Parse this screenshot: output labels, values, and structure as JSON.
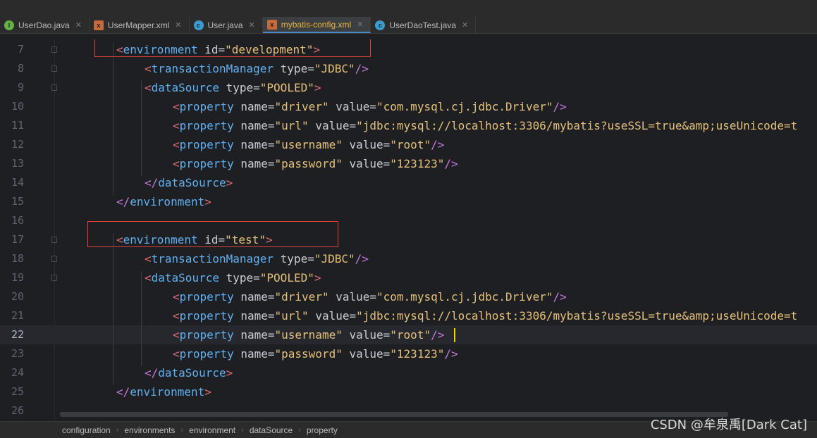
{
  "tabs": [
    {
      "label": "UserDao.java",
      "icon": "interface-icon",
      "icon_color": "#62b543",
      "icon_glyph": "I",
      "active": false
    },
    {
      "label": "UserMapper.xml",
      "icon": "xml-file-icon",
      "icon_color": "#c56a3a",
      "icon_glyph": "x",
      "active": false
    },
    {
      "label": "User.java",
      "icon": "class-icon",
      "icon_color": "#3d9ccf",
      "icon_glyph": "c",
      "active": false
    },
    {
      "label": "mybatis-config.xml",
      "icon": "xml-file-icon",
      "icon_color": "#c56a3a",
      "icon_glyph": "x",
      "active": true
    },
    {
      "label": "UserDaoTest.java",
      "icon": "test-class-icon",
      "icon_color": "#3d9ccf",
      "icon_glyph": "c",
      "active": false
    }
  ],
  "close_glyph": "✕",
  "current_line": 22,
  "lines": [
    {
      "n": "7",
      "tokens": [
        [
          "br",
          "<"
        ],
        [
          "tag",
          "environment"
        ],
        [
          "attr",
          " id"
        ],
        [
          "eq",
          "="
        ],
        [
          "val",
          "\"development\""
        ],
        [
          "br",
          ">"
        ]
      ],
      "indent": 2
    },
    {
      "n": "8",
      "tokens": [
        [
          "br",
          "<"
        ],
        [
          "tag",
          "transactionManager"
        ],
        [
          "attr",
          " type"
        ],
        [
          "eq",
          "="
        ],
        [
          "val",
          "\"JDBC\""
        ],
        [
          "close",
          "/>"
        ]
      ],
      "indent": 3
    },
    {
      "n": "9",
      "tokens": [
        [
          "br",
          "<"
        ],
        [
          "tag",
          "dataSource"
        ],
        [
          "attr",
          " type"
        ],
        [
          "eq",
          "="
        ],
        [
          "val",
          "\"POOLED\""
        ],
        [
          "br",
          ">"
        ]
      ],
      "indent": 3
    },
    {
      "n": "10",
      "tokens": [
        [
          "br",
          "<"
        ],
        [
          "tag",
          "property"
        ],
        [
          "attr",
          " name"
        ],
        [
          "eq",
          "="
        ],
        [
          "val",
          "\"driver\""
        ],
        [
          "attr",
          " value"
        ],
        [
          "eq",
          "="
        ],
        [
          "val",
          "\"com.mysql.cj.jdbc.Driver\""
        ],
        [
          "close",
          "/>"
        ]
      ],
      "indent": 4
    },
    {
      "n": "11",
      "tokens": [
        [
          "br",
          "<"
        ],
        [
          "tag",
          "property"
        ],
        [
          "attr",
          " name"
        ],
        [
          "eq",
          "="
        ],
        [
          "val",
          "\"url\""
        ],
        [
          "attr",
          " value"
        ],
        [
          "eq",
          "="
        ],
        [
          "val",
          "\"jdbc:mysql://localhost:3306/mybatis?useSSL=true&amp;useUnicode=t"
        ]
      ],
      "indent": 4
    },
    {
      "n": "12",
      "tokens": [
        [
          "br",
          "<"
        ],
        [
          "tag",
          "property"
        ],
        [
          "attr",
          " name"
        ],
        [
          "eq",
          "="
        ],
        [
          "val",
          "\"username\""
        ],
        [
          "attr",
          " value"
        ],
        [
          "eq",
          "="
        ],
        [
          "val",
          "\"root\""
        ],
        [
          "close",
          "/>"
        ]
      ],
      "indent": 4
    },
    {
      "n": "13",
      "tokens": [
        [
          "br",
          "<"
        ],
        [
          "tag",
          "property"
        ],
        [
          "attr",
          " name"
        ],
        [
          "eq",
          "="
        ],
        [
          "val",
          "\"password\""
        ],
        [
          "attr",
          " value"
        ],
        [
          "eq",
          "="
        ],
        [
          "val",
          "\"123123\""
        ],
        [
          "close",
          "/>"
        ]
      ],
      "indent": 4
    },
    {
      "n": "14",
      "tokens": [
        [
          "close",
          "</"
        ],
        [
          "tag",
          "dataSource"
        ],
        [
          "br",
          ">"
        ]
      ],
      "indent": 3
    },
    {
      "n": "15",
      "tokens": [
        [
          "close",
          "</"
        ],
        [
          "tag",
          "environment"
        ],
        [
          "br",
          ">"
        ]
      ],
      "indent": 2
    },
    {
      "n": "16",
      "tokens": [],
      "indent": 0
    },
    {
      "n": "17",
      "tokens": [
        [
          "br",
          "<"
        ],
        [
          "tag",
          "environment"
        ],
        [
          "attr",
          " id"
        ],
        [
          "eq",
          "="
        ],
        [
          "val",
          "\"test\""
        ],
        [
          "br",
          ">"
        ]
      ],
      "indent": 2
    },
    {
      "n": "18",
      "tokens": [
        [
          "br",
          "<"
        ],
        [
          "tag",
          "transactionManager"
        ],
        [
          "attr",
          " type"
        ],
        [
          "eq",
          "="
        ],
        [
          "val",
          "\"JDBC\""
        ],
        [
          "close",
          "/>"
        ]
      ],
      "indent": 3
    },
    {
      "n": "19",
      "tokens": [
        [
          "br",
          "<"
        ],
        [
          "tag",
          "dataSource"
        ],
        [
          "attr",
          " type"
        ],
        [
          "eq",
          "="
        ],
        [
          "val",
          "\"POOLED\""
        ],
        [
          "br",
          ">"
        ]
      ],
      "indent": 3
    },
    {
      "n": "20",
      "tokens": [
        [
          "br",
          "<"
        ],
        [
          "tag",
          "property"
        ],
        [
          "attr",
          " name"
        ],
        [
          "eq",
          "="
        ],
        [
          "val",
          "\"driver\""
        ],
        [
          "attr",
          " value"
        ],
        [
          "eq",
          "="
        ],
        [
          "val",
          "\"com.mysql.cj.jdbc.Driver\""
        ],
        [
          "close",
          "/>"
        ]
      ],
      "indent": 4
    },
    {
      "n": "21",
      "tokens": [
        [
          "br",
          "<"
        ],
        [
          "tag",
          "property"
        ],
        [
          "attr",
          " name"
        ],
        [
          "eq",
          "="
        ],
        [
          "val",
          "\"url\""
        ],
        [
          "attr",
          " value"
        ],
        [
          "eq",
          "="
        ],
        [
          "val",
          "\"jdbc:mysql://localhost:3306/mybatis?useSSL=true&amp;useUnicode=t"
        ]
      ],
      "indent": 4
    },
    {
      "n": "22",
      "tokens": [
        [
          "br",
          "<"
        ],
        [
          "tag",
          "property"
        ],
        [
          "attr",
          " name"
        ],
        [
          "eq",
          "="
        ],
        [
          "val",
          "\"username\""
        ],
        [
          "attr",
          " value"
        ],
        [
          "eq",
          "="
        ],
        [
          "val",
          "\"root\""
        ],
        [
          "close",
          "/>"
        ]
      ],
      "indent": 4
    },
    {
      "n": "23",
      "tokens": [
        [
          "br",
          "<"
        ],
        [
          "tag",
          "property"
        ],
        [
          "attr",
          " name"
        ],
        [
          "eq",
          "="
        ],
        [
          "val",
          "\"password\""
        ],
        [
          "attr",
          " value"
        ],
        [
          "eq",
          "="
        ],
        [
          "val",
          "\"123123\""
        ],
        [
          "close",
          "/>"
        ]
      ],
      "indent": 4
    },
    {
      "n": "24",
      "tokens": [
        [
          "close",
          "</"
        ],
        [
          "tag",
          "dataSource"
        ],
        [
          "br",
          ">"
        ]
      ],
      "indent": 3
    },
    {
      "n": "25",
      "tokens": [
        [
          "close",
          "</"
        ],
        [
          "tag",
          "environment"
        ],
        [
          "br",
          ">"
        ]
      ],
      "indent": 2
    },
    {
      "n": "26",
      "tokens": [],
      "indent": 0
    }
  ],
  "breadcrumb": [
    "configuration",
    "environments",
    "environment",
    "dataSource",
    "property"
  ],
  "watermark": "CSDN @牟泉禹[Dark Cat]",
  "colors": {
    "highlight_box": "#e0403a",
    "active_tab_text": "#e8b43a",
    "caret": "#ffcc00"
  }
}
